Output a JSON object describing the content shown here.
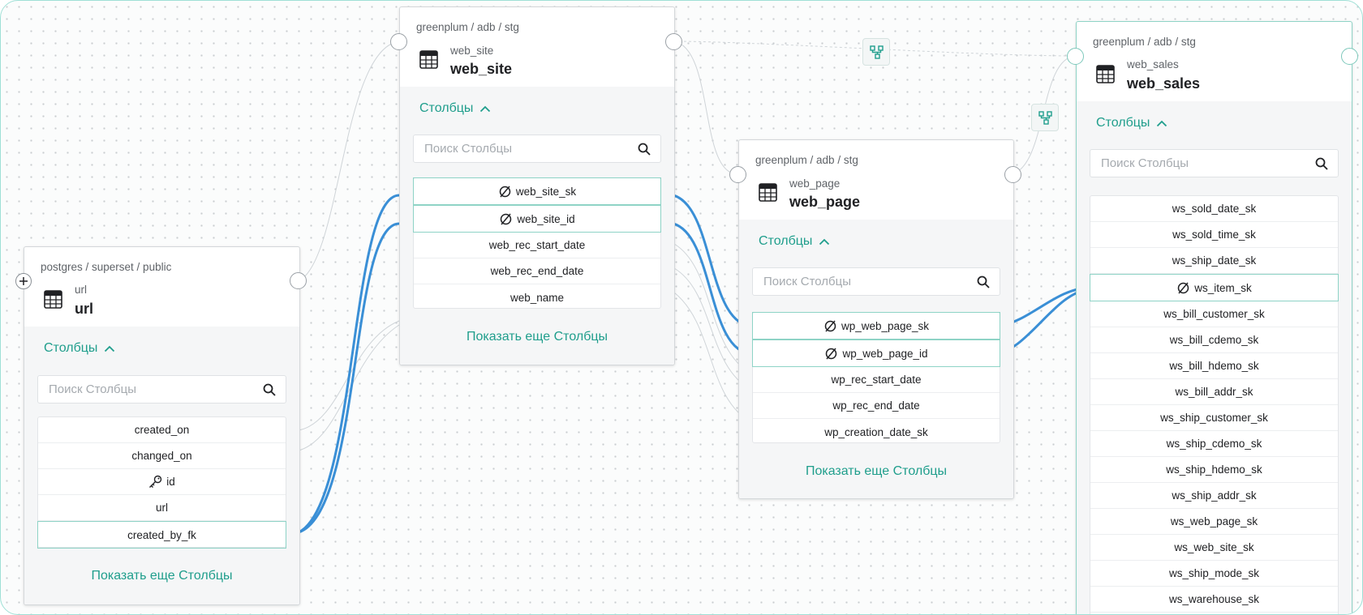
{
  "canvas": {
    "lineage_button_label": "lineage"
  },
  "nodes": {
    "url": {
      "path": "postgres / superset / public",
      "subtitle": "url",
      "title": "url",
      "columns_label": "Столбцы",
      "search_placeholder": "Поиск Столбцы",
      "columns": [
        {
          "name": "created_on",
          "icon": ""
        },
        {
          "name": "changed_on",
          "icon": ""
        },
        {
          "name": "id",
          "icon": "key-icon"
        },
        {
          "name": "url",
          "icon": ""
        },
        {
          "name": "created_by_fk",
          "icon": ""
        }
      ],
      "show_more": "Показать еще Столбцы"
    },
    "web_site": {
      "path": "greenplum / adb / stg",
      "subtitle": "web_site",
      "title": "web_site",
      "columns_label": "Столбцы",
      "search_placeholder": "Поиск Столбцы",
      "columns": [
        {
          "name": "web_site_sk",
          "icon": "null-icon"
        },
        {
          "name": "web_site_id",
          "icon": "null-icon"
        },
        {
          "name": "web_rec_start_date",
          "icon": ""
        },
        {
          "name": "web_rec_end_date",
          "icon": ""
        },
        {
          "name": "web_name",
          "icon": ""
        }
      ],
      "show_more": "Показать еще Столбцы"
    },
    "web_page": {
      "path": "greenplum / adb / stg",
      "subtitle": "web_page",
      "title": "web_page",
      "columns_label": "Столбцы",
      "search_placeholder": "Поиск Столбцы",
      "columns": [
        {
          "name": "wp_web_page_sk",
          "icon": "null-icon"
        },
        {
          "name": "wp_web_page_id",
          "icon": "null-icon"
        },
        {
          "name": "wp_rec_start_date",
          "icon": ""
        },
        {
          "name": "wp_rec_end_date",
          "icon": ""
        },
        {
          "name": "wp_creation_date_sk",
          "icon": ""
        }
      ],
      "show_more": "Показать еще Столбцы"
    },
    "web_sales": {
      "path": "greenplum / adb / stg",
      "subtitle": "web_sales",
      "title": "web_sales",
      "columns_label": "Столбцы",
      "search_placeholder": "Поиск Столбцы",
      "columns": [
        {
          "name": "ws_sold_date_sk",
          "icon": ""
        },
        {
          "name": "ws_sold_time_sk",
          "icon": ""
        },
        {
          "name": "ws_ship_date_sk",
          "icon": ""
        },
        {
          "name": "ws_item_sk",
          "icon": "null-icon"
        },
        {
          "name": "ws_bill_customer_sk",
          "icon": ""
        },
        {
          "name": "ws_bill_cdemo_sk",
          "icon": ""
        },
        {
          "name": "ws_bill_hdemo_sk",
          "icon": ""
        },
        {
          "name": "ws_bill_addr_sk",
          "icon": ""
        },
        {
          "name": "ws_ship_customer_sk",
          "icon": ""
        },
        {
          "name": "ws_ship_cdemo_sk",
          "icon": ""
        },
        {
          "name": "ws_ship_hdemo_sk",
          "icon": ""
        },
        {
          "name": "ws_ship_addr_sk",
          "icon": ""
        },
        {
          "name": "ws_web_page_sk",
          "icon": ""
        },
        {
          "name": "ws_web_site_sk",
          "icon": ""
        },
        {
          "name": "ws_ship_mode_sk",
          "icon": ""
        },
        {
          "name": "ws_warehouse_sk",
          "icon": ""
        }
      ]
    }
  },
  "colors": {
    "accent": "#1f9e8c",
    "highlight_border": "#8ed3c6",
    "edge_highlight": "#3a8fd6",
    "edge_normal": "#c9ced3"
  }
}
